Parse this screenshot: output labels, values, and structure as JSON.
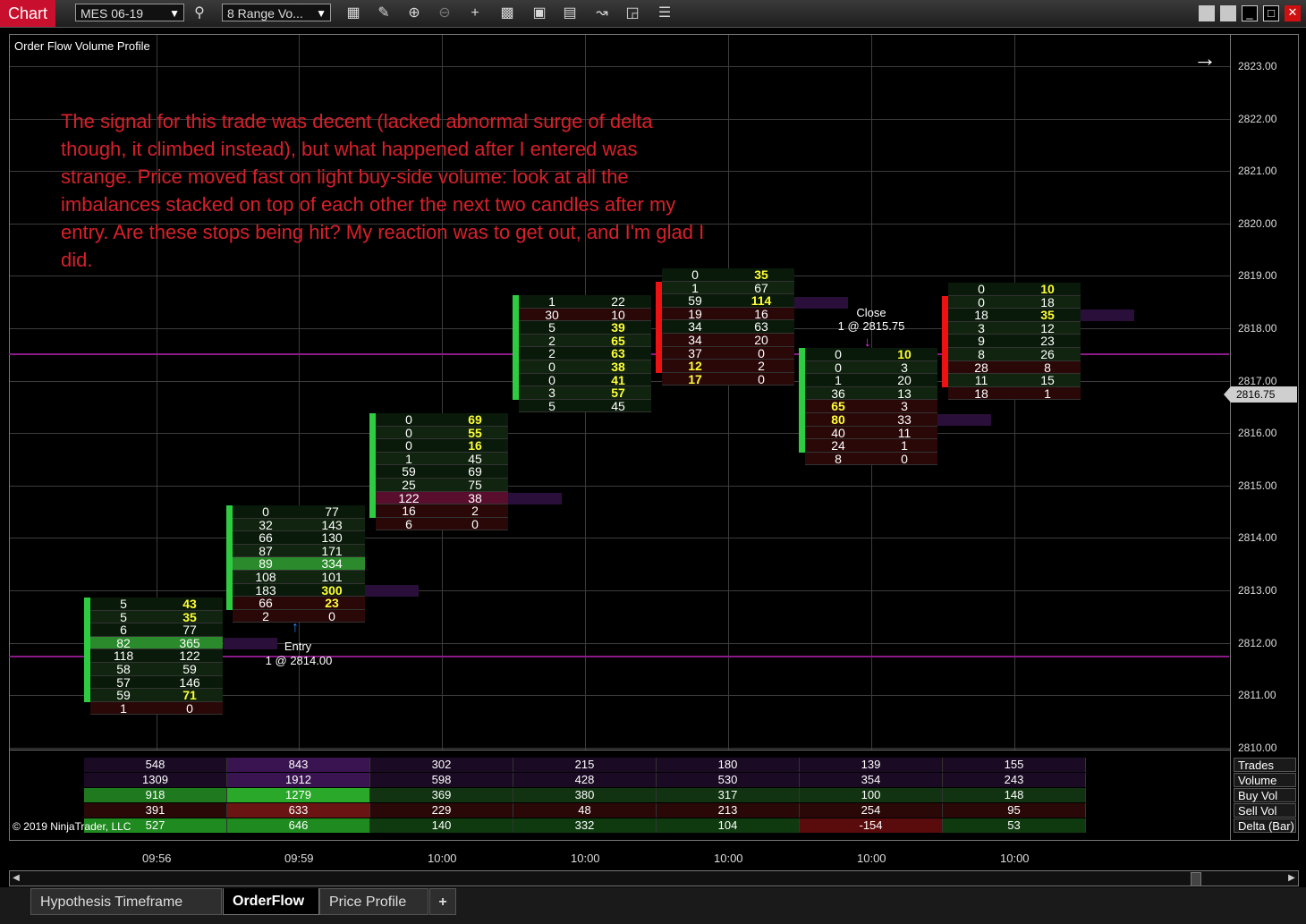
{
  "toolbar": {
    "app_title": "Chart",
    "instrument": "MES 06-19",
    "period": "8 Range Vo..."
  },
  "chart": {
    "title": "Order Flow Volume Profile",
    "copyright": "© 2019 NinjaTrader, LLC",
    "annotation": "The signal for this trade was decent (lacked abnormal surge of delta though, it climbed instead), but what happened after I entered was strange. Price moved fast on light buy-side volume: look at all the imbalances stacked on top of each other the next two candles after my entry. Are these stops being hit? My reaction was to get out, and I'm glad I did.",
    "price_labels": [
      "2823.00",
      "2822.00",
      "2821.00",
      "2820.00",
      "2819.00",
      "2818.00",
      "2817.00",
      "2816.00",
      "2815.00",
      "2814.00",
      "2813.00",
      "2812.00",
      "2811.00",
      "2810.00"
    ],
    "last_price": "2816.75",
    "entry": {
      "label": "Entry",
      "detail": "1 @ 2814.00"
    },
    "close": {
      "label": "Close",
      "detail": "1 @ 2815.75"
    },
    "colors": {
      "bull": "#2ecc40",
      "bear": "#ee1111",
      "line": "#8a1a8a",
      "annotation": "#d8202a",
      "highlight": "#ffff33"
    }
  },
  "bars": [
    {
      "dir": "up",
      "rows": [
        [
          "5",
          "43",
          "h2"
        ],
        [
          "5",
          "35",
          "h2"
        ],
        [
          "6",
          "77",
          ""
        ],
        [
          "82",
          "365",
          "g"
        ],
        [
          "118",
          "122",
          ""
        ],
        [
          "58",
          "59",
          ""
        ],
        [
          "57",
          "146",
          ""
        ],
        [
          "59",
          "71",
          "h2"
        ],
        [
          "1",
          "0",
          "low"
        ]
      ]
    },
    {
      "dir": "up",
      "rows": [
        [
          "0",
          "77",
          ""
        ],
        [
          "32",
          "143",
          ""
        ],
        [
          "66",
          "130",
          ""
        ],
        [
          "87",
          "171",
          ""
        ],
        [
          "89",
          "334",
          "g"
        ],
        [
          "108",
          "101",
          ""
        ],
        [
          "183",
          "300",
          "h2"
        ],
        [
          "66",
          "23",
          "h2r"
        ],
        [
          "2",
          "0",
          "low"
        ]
      ]
    },
    {
      "dir": "up",
      "rows": [
        [
          "0",
          "69",
          "h2"
        ],
        [
          "0",
          "55",
          "h2"
        ],
        [
          "0",
          "16",
          "h2"
        ],
        [
          "1",
          "45",
          ""
        ],
        [
          "59",
          "69",
          ""
        ],
        [
          "25",
          "75",
          ""
        ],
        [
          "122",
          "38",
          "r"
        ],
        [
          "16",
          "2",
          "low"
        ],
        [
          "6",
          "0",
          "low"
        ]
      ]
    },
    {
      "dir": "up",
      "rows": [
        [
          "1",
          "22",
          ""
        ],
        [
          "30",
          "10",
          "r0"
        ],
        [
          "5",
          "39",
          "h2"
        ],
        [
          "2",
          "65",
          "h2"
        ],
        [
          "2",
          "63",
          "h2"
        ],
        [
          "0",
          "38",
          "h2"
        ],
        [
          "0",
          "41",
          "h2"
        ],
        [
          "3",
          "57",
          "h2"
        ],
        [
          "5",
          "45",
          ""
        ]
      ]
    },
    {
      "dir": "down",
      "rows": [
        [
          "0",
          "35",
          "h2"
        ],
        [
          "1",
          "67",
          ""
        ],
        [
          "59",
          "114",
          "h2"
        ],
        [
          "19",
          "16",
          "r0"
        ],
        [
          "34",
          "63",
          ""
        ],
        [
          "34",
          "20",
          "r0"
        ],
        [
          "37",
          "0",
          "r0"
        ],
        [
          "12",
          "2",
          "h1"
        ],
        [
          "17",
          "0",
          "h1"
        ]
      ]
    },
    {
      "dir": "up",
      "rows": [
        [
          "0",
          "10",
          "h2"
        ],
        [
          "0",
          "3",
          ""
        ],
        [
          "1",
          "20",
          ""
        ],
        [
          "36",
          "13",
          ""
        ],
        [
          "65",
          "3",
          "h1"
        ],
        [
          "80",
          "33",
          "h1"
        ],
        [
          "40",
          "11",
          "r0"
        ],
        [
          "24",
          "1",
          "r0"
        ],
        [
          "8",
          "0",
          "r0"
        ]
      ]
    },
    {
      "dir": "down",
      "rows": [
        [
          "0",
          "10",
          "h2"
        ],
        [
          "0",
          "18",
          ""
        ],
        [
          "18",
          "35",
          "h2"
        ],
        [
          "3",
          "12",
          ""
        ],
        [
          "9",
          "23",
          ""
        ],
        [
          "8",
          "26",
          ""
        ],
        [
          "28",
          "8",
          "r0"
        ],
        [
          "11",
          "15",
          ""
        ],
        [
          "18",
          "1",
          "r0"
        ]
      ]
    }
  ],
  "summary": {
    "labels": [
      "Trades",
      "Volume",
      "Buy Vol",
      "Sell Vol",
      "Delta (Bar)"
    ],
    "trades": [
      "548",
      "843",
      "302",
      "215",
      "180",
      "139",
      "155"
    ],
    "volume": [
      "1309",
      "1912",
      "598",
      "428",
      "530",
      "354",
      "243"
    ],
    "buy_vol": [
      "918",
      "1279",
      "369",
      "380",
      "317",
      "100",
      "148"
    ],
    "sell_vol": [
      "391",
      "633",
      "229",
      "48",
      "213",
      "254",
      "95"
    ],
    "delta": [
      "527",
      "646",
      "140",
      "332",
      "104",
      "-154",
      "53"
    ]
  },
  "time_labels": [
    "09:56",
    "09:59",
    "10:00",
    "10:00",
    "10:00",
    "10:00",
    "10:00"
  ],
  "tabs": [
    "Hypothesis Timeframe",
    "OrderFlow",
    "Price Profile",
    "+"
  ],
  "active_tab": "OrderFlow"
}
